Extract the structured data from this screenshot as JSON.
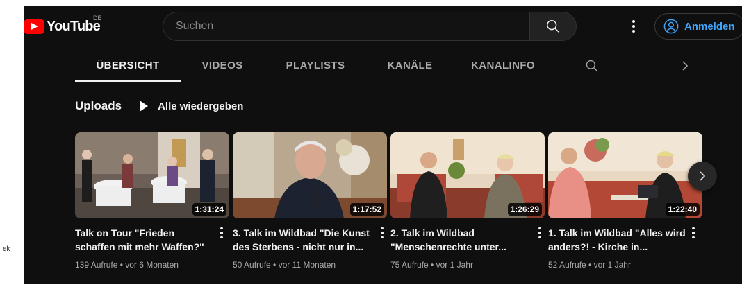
{
  "header": {
    "logo_text": "YouTube",
    "country_code": "DE",
    "search_placeholder": "Suchen",
    "signin_label": "Anmelden"
  },
  "tabs": [
    {
      "label": "ÜBERSICHT",
      "active": true
    },
    {
      "label": "VIDEOS",
      "active": false
    },
    {
      "label": "PLAYLISTS",
      "active": false
    },
    {
      "label": "KANÄLE",
      "active": false
    },
    {
      "label": "KANALINFO",
      "active": false
    }
  ],
  "shelf": {
    "title": "Uploads",
    "play_all_label": "Alle wiedergeben"
  },
  "videos": [
    {
      "title": "Talk on Tour \"Frieden schaffen mit mehr Waffen?\"",
      "duration": "1:31:24",
      "meta": "139 Aufrufe • vor 6 Monaten"
    },
    {
      "title": "3. Talk im Wildbad \"Die Kunst des Sterbens - nicht nur in...",
      "duration": "1:17:52",
      "meta": "50 Aufrufe • vor 11 Monaten"
    },
    {
      "title": "2. Talk im Wildbad \"Menschenrechte unter...",
      "duration": "1:26:29",
      "meta": "75 Aufrufe • vor 1 Jahr"
    },
    {
      "title": "1. Talk im Wildbad \"Alles wird anders?! - Kirche in...",
      "duration": "1:22:40",
      "meta": "52 Aufrufe • vor 1 Jahr"
    }
  ],
  "side_fragment": "ek",
  "colors": {
    "background": "#0f0f0f",
    "brand_red": "#ff0000",
    "link_blue": "#3ea6ff",
    "text_primary": "#f1f1f1",
    "text_secondary": "#aaaaaa"
  }
}
